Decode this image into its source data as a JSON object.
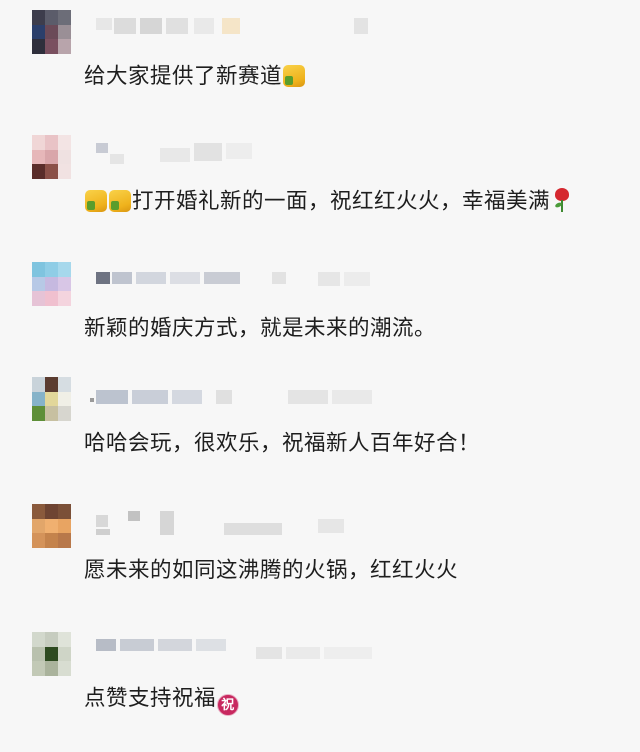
{
  "comments": [
    {
      "text": "给大家提供了新赛道",
      "emoji": "thumbs-up-icon"
    },
    {
      "text": "打开婚礼新的一面，祝红红火火，幸福美满",
      "emoji_before": [
        "thumbs-up-icon",
        "thumbs-up-icon"
      ],
      "emoji_after": "rose-icon"
    },
    {
      "text": "新颖的婚庆方式，就是未来的潮流。"
    },
    {
      "text": "哈哈会玩，很欢乐，祝福新人百年好合！"
    },
    {
      "text": "愿未来的如同这沸腾的火锅，红红火火"
    },
    {
      "text": "点赞支持祝福",
      "emoji": "blessing-icon",
      "emoji_label": "祝"
    }
  ]
}
